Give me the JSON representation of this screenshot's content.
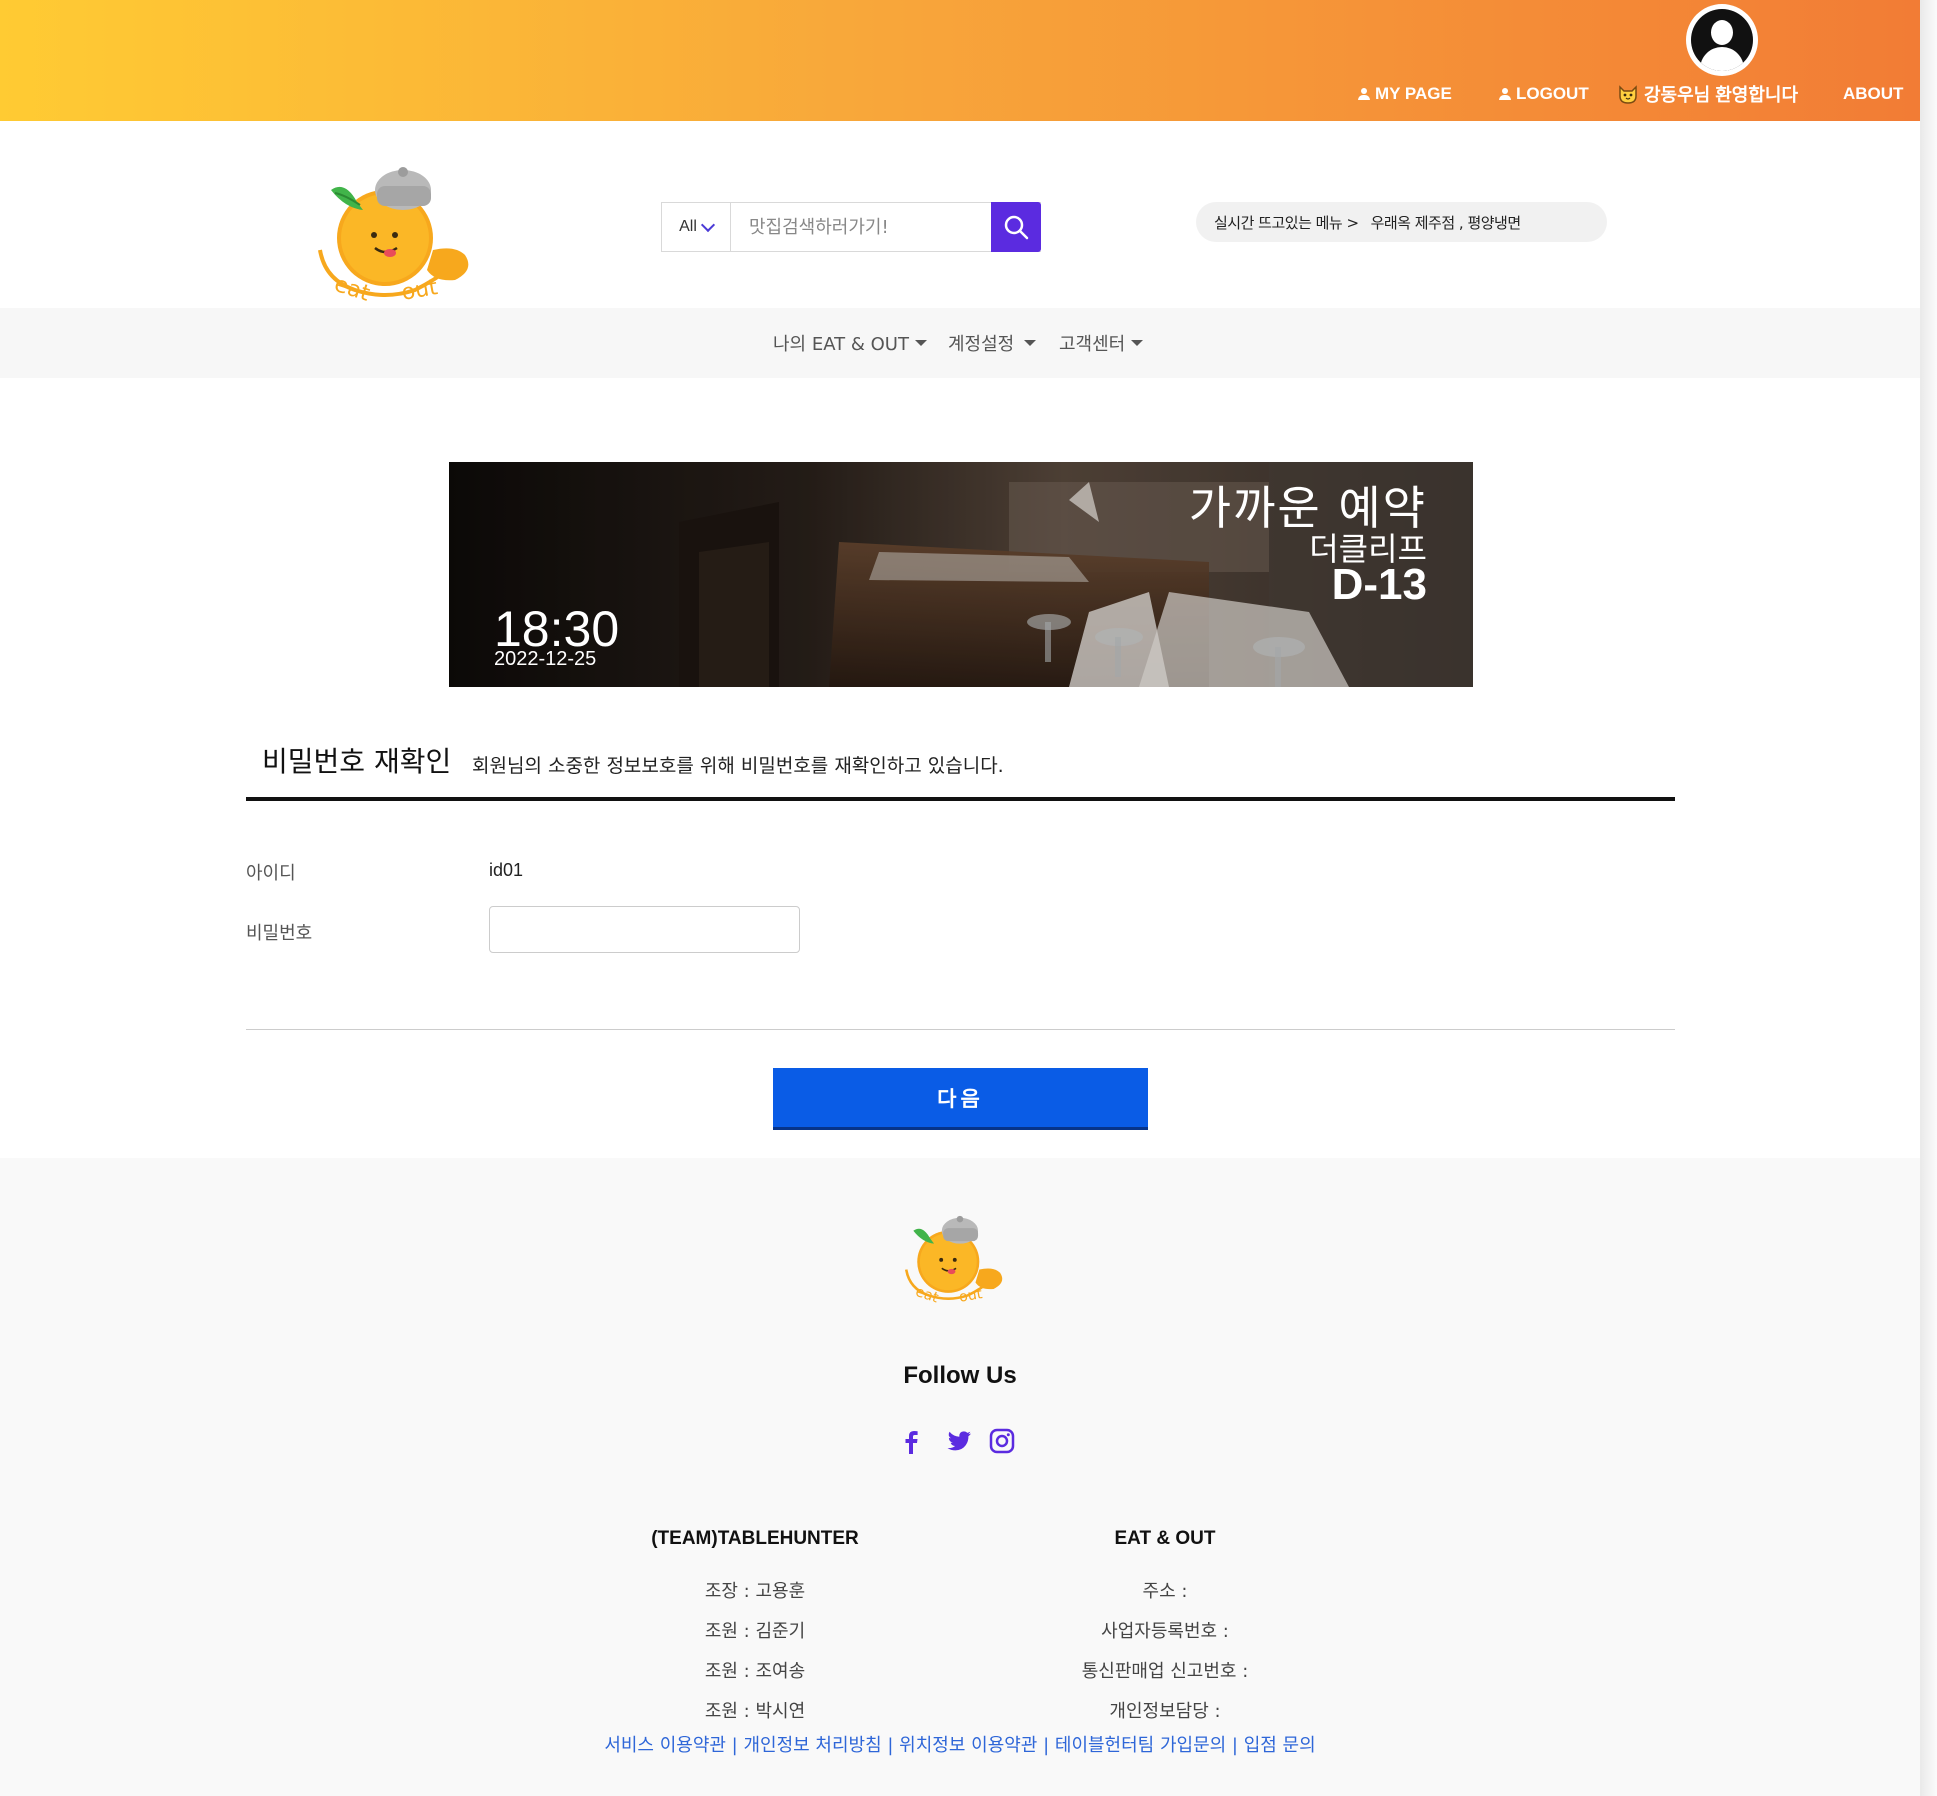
{
  "topbar": {
    "mypage": "MY PAGE",
    "logout": "LOGOUT",
    "welcome_icon": "cat-face-icon",
    "welcome": "강동우님 환영합니다",
    "about": "ABOUT"
  },
  "search": {
    "category": "All",
    "placeholder": "맛집검색하러가기!"
  },
  "realtime": {
    "label": "실시간 뜨고있는 메뉴 >",
    "items": "우래옥 제주점 , 평양냉면"
  },
  "nav": {
    "items": [
      {
        "label": "나의 EAT & OUT"
      },
      {
        "label": "계정설정"
      },
      {
        "label": "고객센터"
      }
    ]
  },
  "banner": {
    "title": "가까운 예약",
    "restaurant": "더클리프",
    "dday": "D-13",
    "time": "18:30",
    "date": "2022-12-25"
  },
  "form": {
    "title": "비밀번호 재확인",
    "description": "회원님의 소중한 정보보호를 위해 비밀번호를 재확인하고 있습니다.",
    "id_label": "아이디",
    "id_value": "id01",
    "pw_label": "비밀번호",
    "pw_value": "",
    "next_label": "다음"
  },
  "footer": {
    "follow": "Follow Us",
    "social": [
      "facebook-icon",
      "twitter-icon",
      "instagram-icon"
    ],
    "team": {
      "title": "(TEAM)TABLEHUNTER",
      "lines": [
        "조장 : 고용훈",
        "조원 : 김준기",
        "조원 : 조여송",
        "조원 : 박시연"
      ]
    },
    "company": {
      "title": "EAT & OUT",
      "lines": [
        "주소 :",
        "사업자등록번호 :",
        "통신판매업 신고번호 :",
        "개인정보담당 :"
      ]
    },
    "links": "서비스 이용약관 | 개인정보 처리방침 | 위치정보 이용약관 | 테이블헌터팀 가입문의 | 입점 문의"
  },
  "colors": {
    "accent": "#5b2be0",
    "primary_button": "#0a5ce6",
    "topbar_start": "#ffcb33",
    "topbar_end": "#f27c35",
    "link": "#2e66d8"
  }
}
